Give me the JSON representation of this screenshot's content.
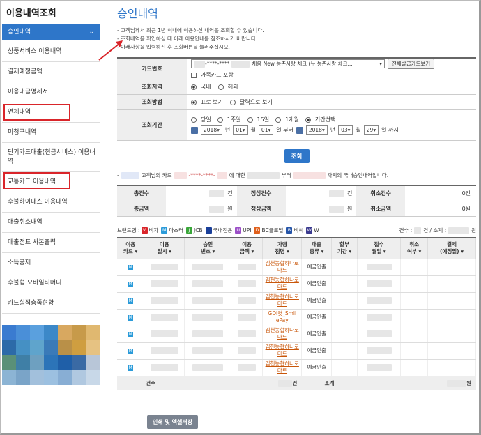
{
  "sidebar": {
    "title": "이용내역조회",
    "active_item": "승인내역",
    "items": [
      {
        "label": "상품서비스 이용내역"
      },
      {
        "label": "결제예정금액"
      },
      {
        "label": "이용대금명세서"
      },
      {
        "label": "연체내역"
      },
      {
        "label": "미청구내역"
      },
      {
        "label": "단기카드대출(현금서비스) 이용내역"
      },
      {
        "label": "교통카드 이용내역"
      },
      {
        "label": "후불하이패스 이용내역"
      },
      {
        "label": "매출취소내역"
      },
      {
        "label": "매출전표 사본출력"
      },
      {
        "label": "소득공제"
      },
      {
        "label": "후불형 모바일티머니"
      },
      {
        "label": "카드실적충족현황"
      }
    ]
  },
  "page": {
    "title": "승인내역",
    "notes": [
      "고객님께서 최근 1년 이내에 이용하신 내역을 조회할 수 있습니다.",
      "조회내역을 확인하실 때 아래 이용안내를 참조하시기 바랍니다.",
      "아래사항을 입력하신 후 조회버튼을 눌러주십시오."
    ]
  },
  "form": {
    "card_label": "카드번호",
    "card_number_masked": "-****-****",
    "card_name": "채움 New 농촌사랑 체크 (뉴 농촌사랑 체크...",
    "all_cards_button": "전체발급카드보기",
    "family_card_label": "가족카드 포함",
    "region_label": "조회지역",
    "region_options": [
      "국내",
      "해외"
    ],
    "method_label": "조회방법",
    "method_options": [
      "표로 보기",
      "달력으로 보기"
    ],
    "period_label": "조회기간",
    "period_options": [
      "당일",
      "1주일",
      "15일",
      "1개월",
      "기간선택"
    ],
    "start": {
      "year": "2018",
      "month": "01",
      "day": "01"
    },
    "end": {
      "year": "2018",
      "month": "03",
      "day": "29"
    },
    "unit_year": "년",
    "unit_month": "월",
    "unit_day_from": "일 부터",
    "unit_day_to": "일 까지",
    "search_button": "조회"
  },
  "summary": {
    "prefix": "-",
    "customer_suffix": "고객님의 카드",
    "card_masked": "-****-****-",
    "about": "에 대한",
    "from": "부터",
    "to_text": "까지의 국내승인내역입니다."
  },
  "totals": {
    "row1": [
      {
        "label": "총건수",
        "value": "",
        "unit": "건"
      },
      {
        "label": "정상건수",
        "value": "",
        "unit": "건"
      },
      {
        "label": "취소건수",
        "value": "0건",
        "unit": ""
      }
    ],
    "row2": [
      {
        "label": "총금액",
        "value": "",
        "unit": "원"
      },
      {
        "label": "정상금액",
        "value": "",
        "unit": "원"
      },
      {
        "label": "취소금액",
        "value": "0원",
        "unit": ""
      }
    ]
  },
  "brands": {
    "label": "브랜드명 :",
    "items": [
      {
        "code": "V",
        "name": "비자",
        "color": "#d9252a"
      },
      {
        "code": "M",
        "name": "마스터",
        "color": "#2b9bd9"
      },
      {
        "code": "J",
        "name": "JCB",
        "color": "#3aa63a"
      },
      {
        "code": "L",
        "name": "국내전용",
        "color": "#1a3f99"
      },
      {
        "code": "U",
        "name": "UPI",
        "color": "#9b4fc7"
      },
      {
        "code": "D",
        "name": "BC글로벌",
        "color": "#e0601c"
      },
      {
        "code": "B",
        "name": "비씨",
        "color": "#2655a8"
      },
      {
        "code": "W",
        "name": "W",
        "color": "#3b3b8f"
      }
    ],
    "count_label": "건수 :",
    "count_unit": "건 / 소계 :",
    "amount_unit": "원"
  },
  "table": {
    "headers": [
      "이용\n카드",
      "이용\n일시",
      "승인\n번호",
      "이용\n금액",
      "가맹\n점명",
      "매출\n종류",
      "할부\n기간",
      "접수\n월일",
      "취소\n여부",
      "결제\n(예정일)"
    ],
    "rows": [
      {
        "brand": "M",
        "merchant": "김천농협하나로마트",
        "type": "예금인출"
      },
      {
        "brand": "M",
        "merchant": "김천농협하나로마트",
        "type": "예금인출"
      },
      {
        "brand": "M",
        "merchant": "김천농협하나로마트",
        "type": "예금인출"
      },
      {
        "brand": "M",
        "merchant": "GDI컷_Smil ePay",
        "type": "예금인출"
      },
      {
        "brand": "M",
        "merchant": "김천농협하나로마트",
        "type": "예금인출"
      },
      {
        "brand": "M",
        "merchant": "김천농협하나로마트",
        "type": "예금인출"
      },
      {
        "brand": "M",
        "merchant": "김천농협하나로마트",
        "type": "예금인출"
      }
    ],
    "footer": {
      "count_label": "건수",
      "count_unit": "건",
      "subtotal_label": "소계",
      "amount_unit": "원"
    }
  },
  "export_button": "인쇄 및 엑셀저장",
  "colors": {
    "accent": "#2e76c9",
    "highlight": "#d9252a",
    "merchant": "#c9570b"
  }
}
